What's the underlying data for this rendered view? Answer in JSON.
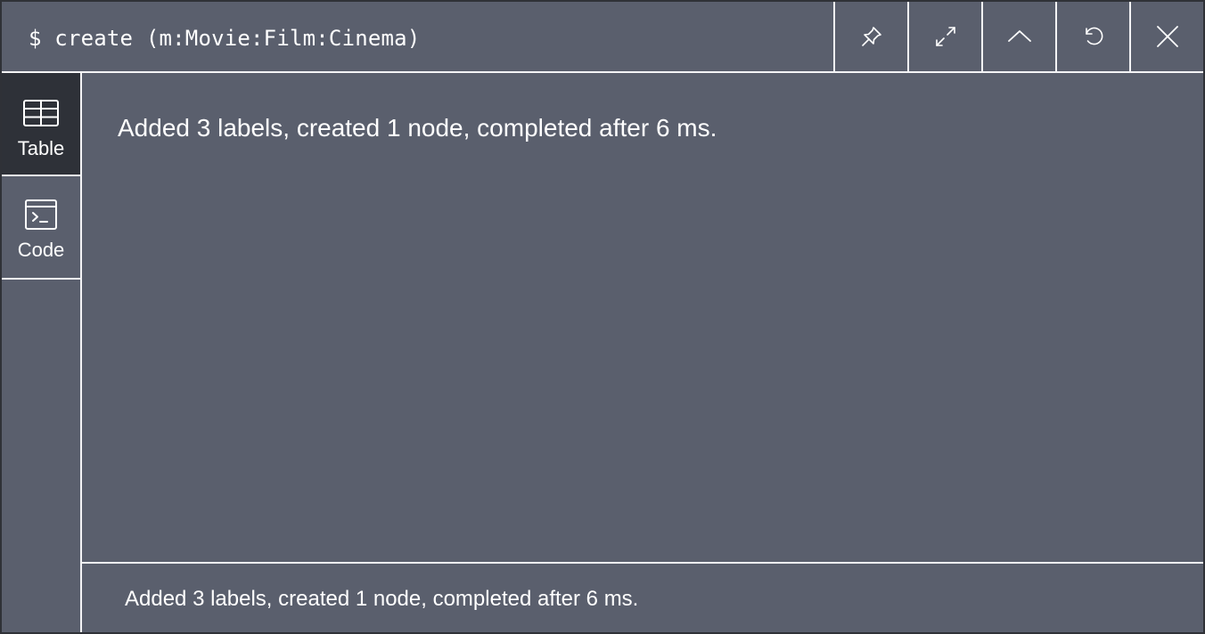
{
  "header": {
    "query": "$ create (m:Movie:Film:Cinema)",
    "actions": [
      {
        "name": "pin",
        "icon": "pin-icon"
      },
      {
        "name": "fullscreen",
        "icon": "expand-icon"
      },
      {
        "name": "collapse",
        "icon": "chevron-up-icon"
      },
      {
        "name": "rerun",
        "icon": "refresh-icon"
      },
      {
        "name": "close",
        "icon": "close-icon"
      }
    ]
  },
  "sidebar": {
    "tabs": [
      {
        "label": "Table",
        "icon": "table-icon",
        "active": true
      },
      {
        "label": "Code",
        "icon": "terminal-icon",
        "active": false
      }
    ]
  },
  "main": {
    "message": "Added 3 labels, created 1 node, completed after 6 ms."
  },
  "status": {
    "message": "Added 3 labels, created 1 node, completed after 6 ms."
  },
  "colors": {
    "background": "#5a5f6d",
    "active_tab": "#2e3138",
    "border": "#f4f4f6",
    "text": "#ffffff"
  }
}
